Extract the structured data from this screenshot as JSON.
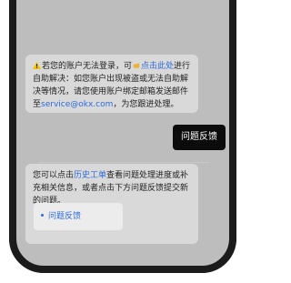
{
  "message1": {
    "before": "若您的账户无法登录，可",
    "link": "点击此处",
    "after": "进行自助解决：如您账户出现被盗或无法自助解决等情况，请您使用账户绑定邮箱发送邮件至",
    "email": "service@okx.com",
    "end": "，为您跟进处理。"
  },
  "feedback_right": {
    "label": "问题反馈"
  },
  "message2": {
    "before": "您可以点击",
    "link": "历史工单",
    "after": "查看问题处理进度或补充相关信息，或者点击下方问题反馈提交新的问题。"
  },
  "faq": {
    "label": "问题反馈"
  }
}
